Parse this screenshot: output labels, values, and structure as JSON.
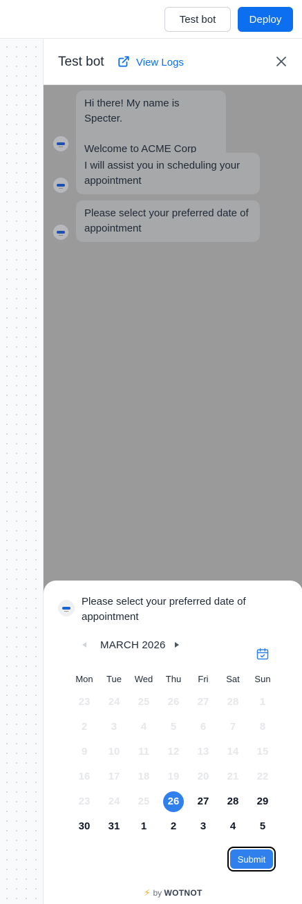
{
  "topbar": {
    "test_bot_label": "Test bot",
    "deploy_label": "Deploy",
    "accent_color": "#0b6ff0"
  },
  "panel": {
    "title": "Test bot",
    "view_logs_label": "View Logs",
    "external_link_icon": "external-link-icon",
    "close_icon": "close-icon"
  },
  "chat": {
    "overlay_color": "#9a9a9a",
    "messages": [
      {
        "lines": [
          "Hi there! My name is Specter.",
          "",
          "Welcome to ACME Corp"
        ]
      },
      {
        "lines": [
          "I will assist you in scheduling your",
          "appointment"
        ]
      },
      {
        "lines": [
          "Please select your preferred date of",
          "appointment"
        ]
      }
    ]
  },
  "picker": {
    "prompt": "Please select your preferred date of appointment",
    "month_label": "MARCH 2026",
    "calendar_icon": "calendar-check-icon",
    "weekdays": [
      "Mon",
      "Tue",
      "Wed",
      "Thu",
      "Fri",
      "Sat",
      "Sun"
    ],
    "weeks": [
      [
        "23",
        "24",
        "25",
        "26",
        "27",
        "28",
        "1"
      ],
      [
        "2",
        "3",
        "4",
        "5",
        "6",
        "7",
        "8"
      ],
      [
        "9",
        "10",
        "11",
        "12",
        "13",
        "14",
        "15"
      ],
      [
        "16",
        "17",
        "18",
        "19",
        "20",
        "21",
        "22"
      ],
      [
        "23",
        "24",
        "25",
        "26",
        "27",
        "28",
        "29"
      ],
      [
        "30",
        "31",
        "1",
        "2",
        "3",
        "4",
        "5"
      ]
    ],
    "selected_day": "26",
    "selected_color": "#2f80ed",
    "submit_label": "Submit"
  },
  "footer": {
    "by_label": "by",
    "brand": "WOTNOT"
  }
}
